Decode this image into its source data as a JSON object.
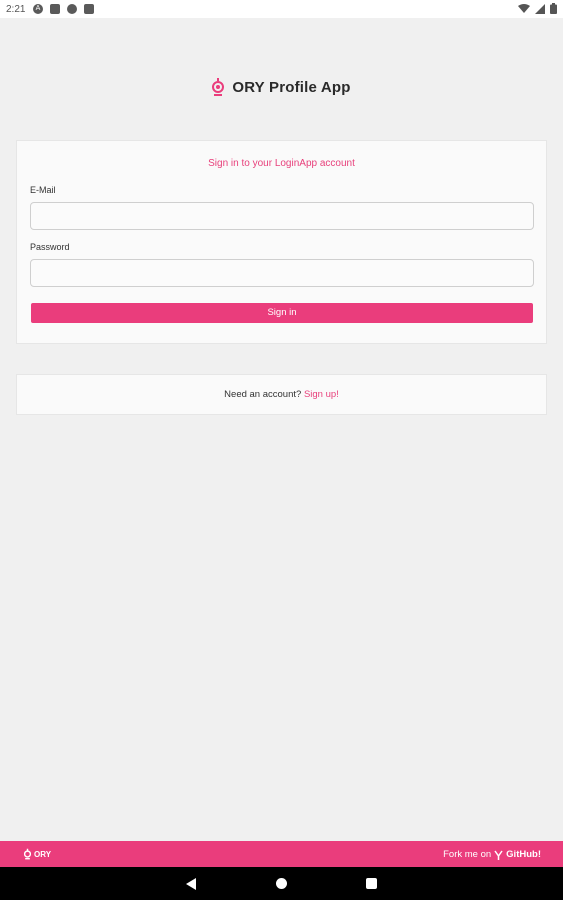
{
  "status_bar": {
    "time": "2:21",
    "left_icons": [
      "a-icon",
      "message-icon",
      "sync-icon",
      "sd-card-icon"
    ],
    "right_icons": [
      "wifi-icon",
      "signal-icon",
      "battery-icon"
    ]
  },
  "header": {
    "title": "ORY Profile App",
    "logo_icon": "ory-logo-icon"
  },
  "login": {
    "heading": "Sign in to your LoginApp account",
    "email_label": "E-Mail",
    "email_value": "",
    "email_placeholder": "",
    "password_label": "Password",
    "password_value": "",
    "password_placeholder": "",
    "submit_label": "Sign in"
  },
  "signup": {
    "prompt": "Need an account?",
    "link_label": "Sign up!"
  },
  "footer": {
    "logo_text": "ORY",
    "fork_text": "Fork me on",
    "github_label": "GitHub!"
  },
  "colors": {
    "accent": "#ea3d7c",
    "background": "#f0f0f0",
    "card": "#fafafa"
  },
  "nav": {
    "buttons": [
      "back-icon",
      "home-icon",
      "recents-icon"
    ]
  }
}
